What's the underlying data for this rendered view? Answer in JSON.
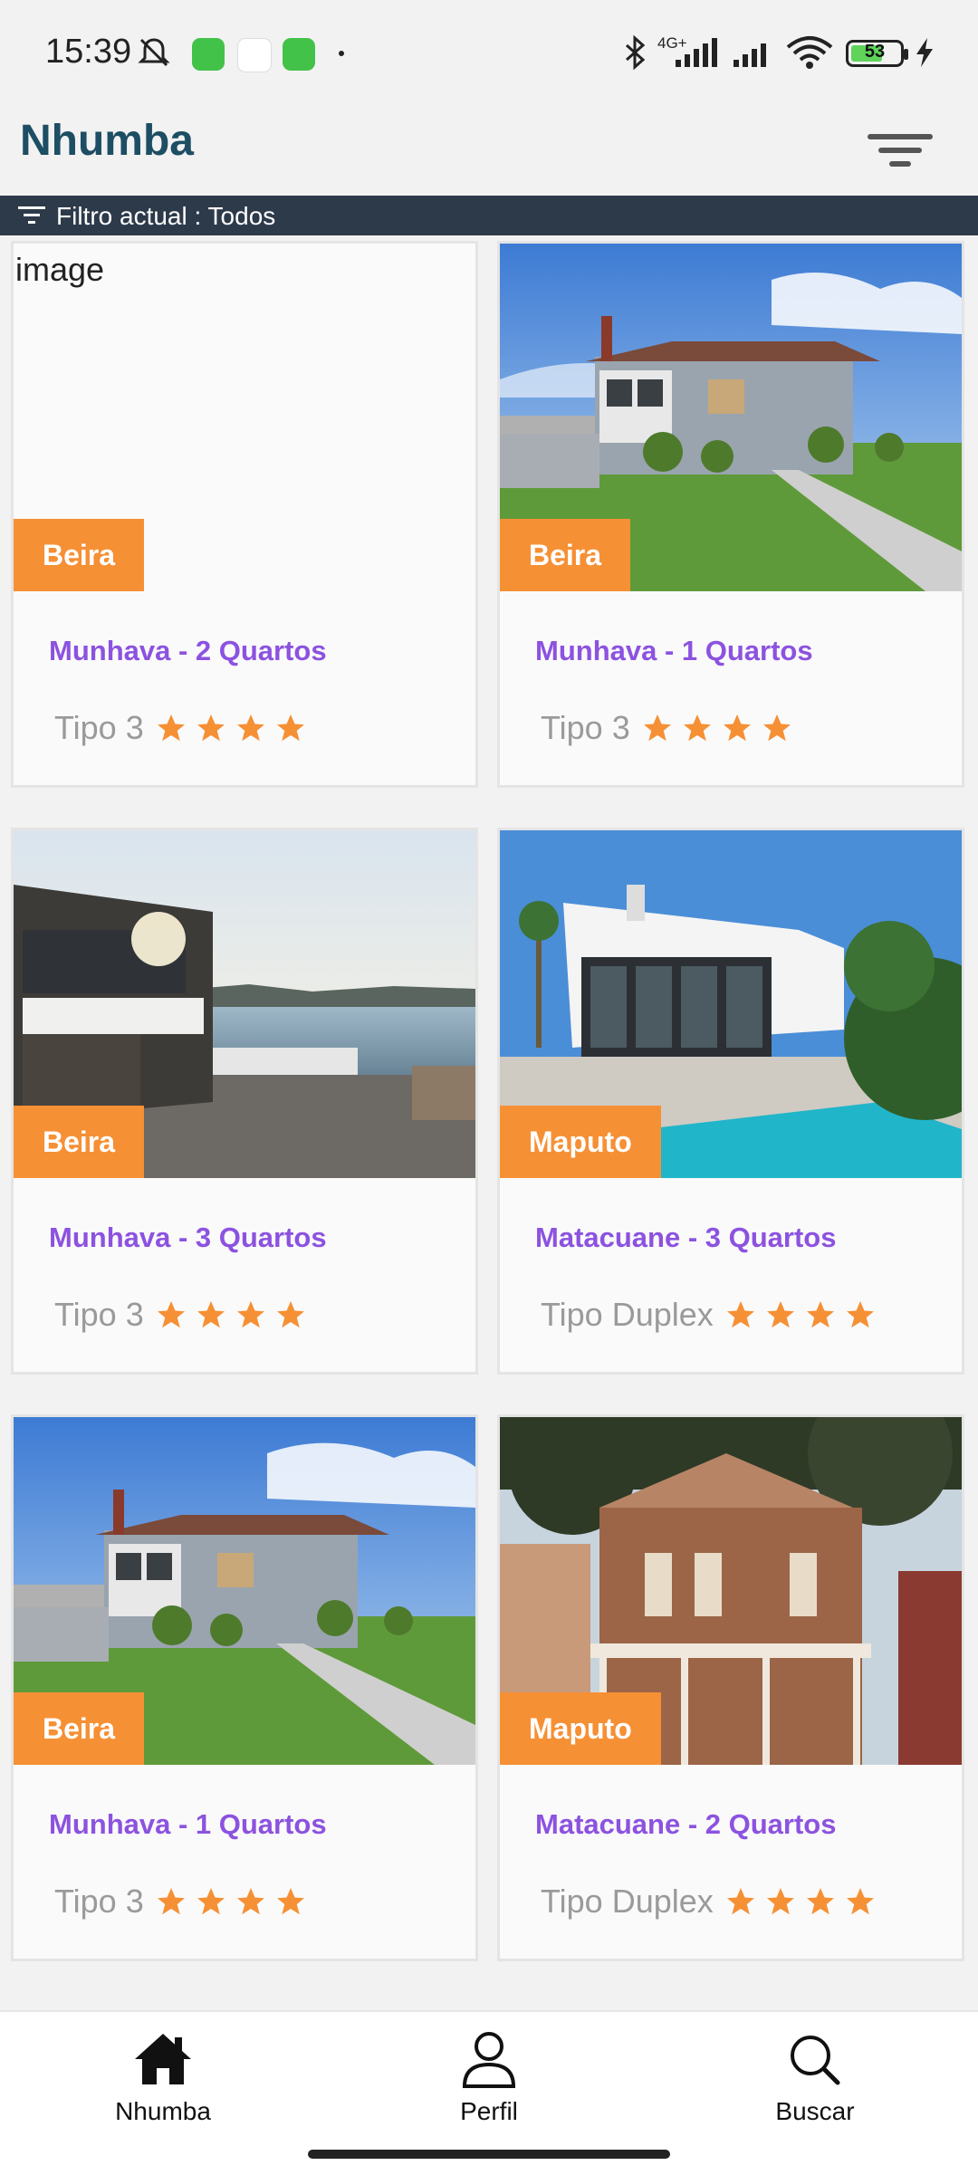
{
  "status_bar": {
    "time": "15:39",
    "network": "4G+",
    "battery": "53",
    "icons": [
      "mute-bell-icon",
      "app-icon",
      "app-icon",
      "dot-icon",
      "bluetooth-icon",
      "signal-icon",
      "signal-icon",
      "wifi-icon",
      "battery-icon",
      "charging-icon"
    ]
  },
  "header": {
    "title": "Nhumba",
    "menu_icon": "filter-menu-icon"
  },
  "filter": {
    "text": "Filtro actual : Todos"
  },
  "listings": [
    {
      "city": "Beira",
      "title": "Munhava - 2 Quartos",
      "type": "Tipo 3",
      "rating": 4,
      "image_alt": "image",
      "image": "none"
    },
    {
      "city": "Beira",
      "title": "Munhava - 1 Quartos",
      "type": "Tipo 3",
      "rating": 4,
      "image": "grey-house-photo"
    },
    {
      "city": "Beira",
      "title": "Munhava - 3 Quartos",
      "type": "Tipo 3",
      "rating": 4,
      "image": "seaside-house-photo"
    },
    {
      "city": "Maputo",
      "title": "Matacuane - 3 Quartos",
      "type": "Tipo Duplex",
      "rating": 4,
      "image": "modern-pool-house-photo"
    },
    {
      "city": "Beira",
      "title": "Munhava - 1 Quartos",
      "type": "Tipo 3",
      "rating": 4,
      "image": "grey-house-photo"
    },
    {
      "city": "Maputo",
      "title": "Matacuane - 2 Quartos",
      "type": "Tipo Duplex",
      "rating": 4,
      "image": "victorian-house-photo"
    }
  ],
  "nav": {
    "items": [
      {
        "label": "Nhumba",
        "icon": "home-icon"
      },
      {
        "label": "Perfil",
        "icon": "user-icon"
      },
      {
        "label": "Buscar",
        "icon": "search-icon"
      }
    ]
  },
  "colors": {
    "brand": "#1d4e63",
    "filter_bar": "#2d3a4a",
    "badge": "#f69035",
    "title": "#8c52e0",
    "star": "#f69035"
  }
}
